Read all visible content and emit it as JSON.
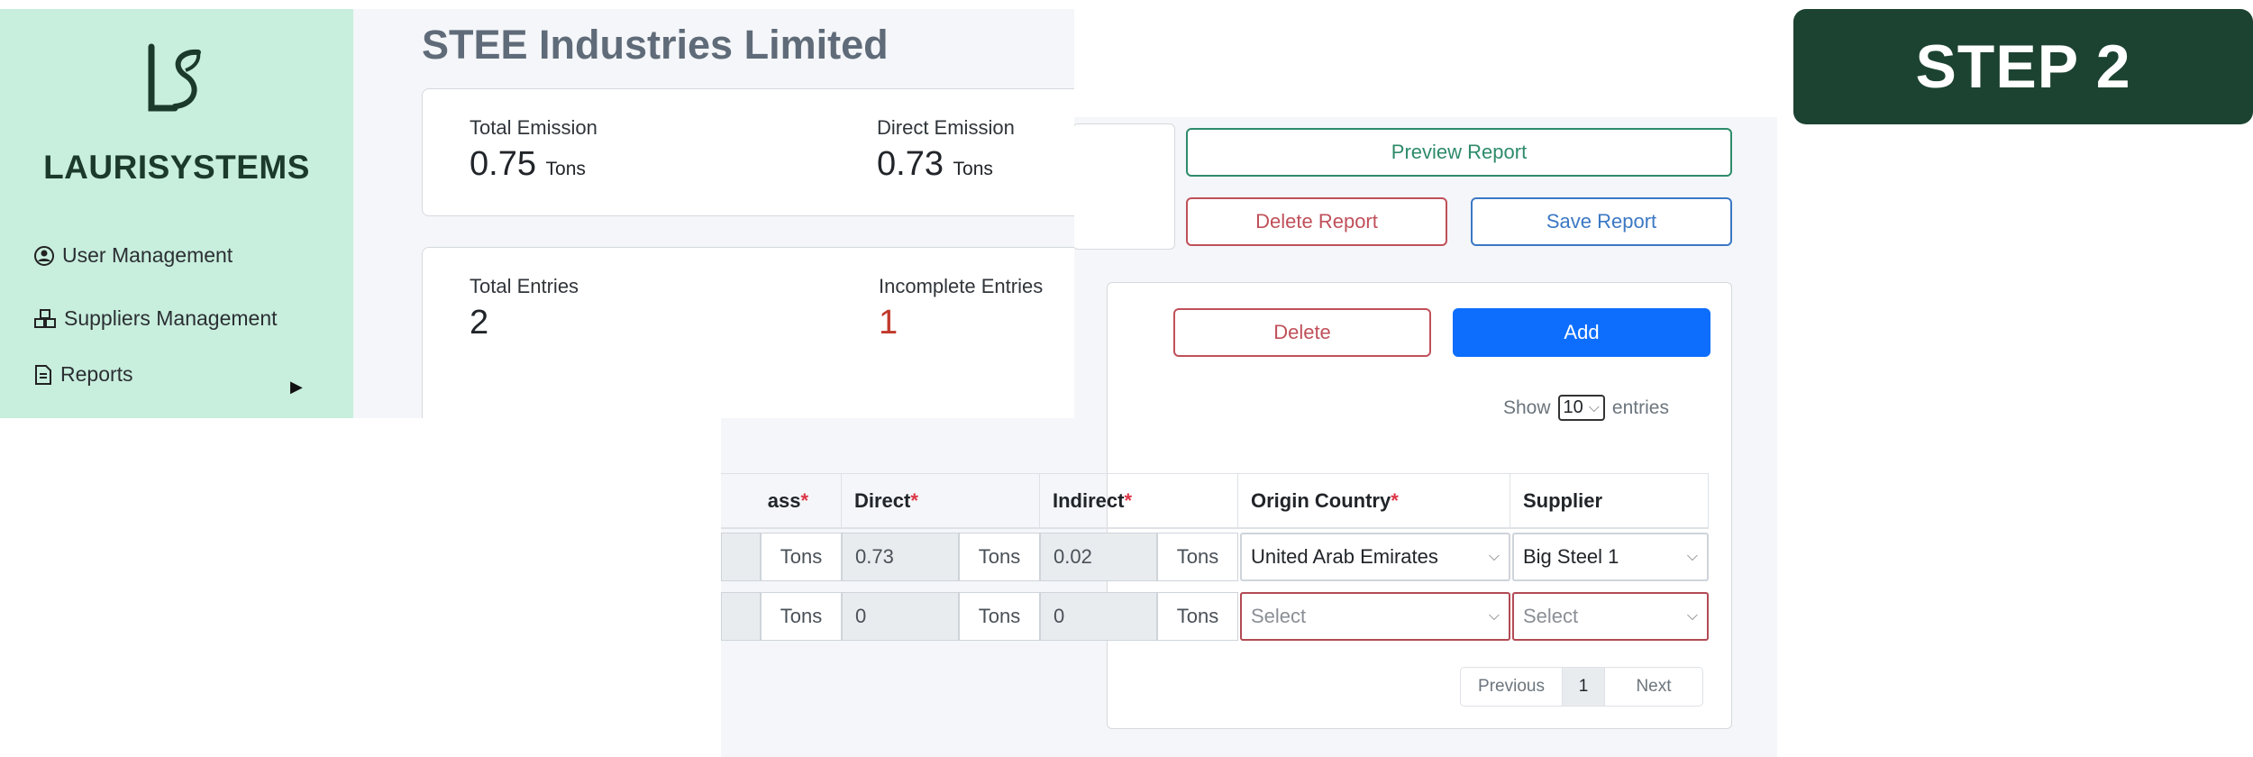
{
  "step_badge": "STEP 2",
  "sidebar": {
    "brand_mark": "LS",
    "brand_name": "LAURISYSTEMS",
    "items": [
      {
        "label": "User Management",
        "icon": "user-circle-icon"
      },
      {
        "label": "Suppliers Management",
        "icon": "boxes-icon"
      },
      {
        "label": "Reports",
        "icon": "document-icon"
      }
    ]
  },
  "header": {
    "company": "STEE Industries Limited"
  },
  "stats": {
    "total_emission": {
      "label": "Total Emission",
      "value": "0.75",
      "unit": "Tons"
    },
    "direct_emission": {
      "label": "Direct Emission",
      "value": "0.73",
      "unit": "Tons"
    },
    "total_entries": {
      "label": "Total Entries",
      "value": "2"
    },
    "incomplete_entries": {
      "label": "Incomplete Entries",
      "value": "1"
    }
  },
  "report_actions": {
    "preview": "Preview Report",
    "delete": "Delete Report",
    "save": "Save Report"
  },
  "entries": {
    "delete": "Delete",
    "add": "Add",
    "show_label": "Show",
    "page_size": "10",
    "entries_label": "entries",
    "columns": {
      "mass": "ass",
      "direct": "Direct",
      "indirect": "Indirect",
      "origin": "Origin Country",
      "supplier": "Supplier",
      "required_mark": "*"
    },
    "rows": [
      {
        "mass_unit": "Tons",
        "direct": "0.73",
        "direct_unit": "Tons",
        "indirect": "0.02",
        "indirect_unit": "Tons",
        "origin": "United Arab Emirates",
        "supplier": "Big Steel 1"
      },
      {
        "mass_unit": "Tons",
        "direct": "0",
        "direct_unit": "Tons",
        "indirect": "0",
        "indirect_unit": "Tons",
        "origin": "Select",
        "supplier": "Select"
      }
    ],
    "pagination": {
      "previous": "Previous",
      "page": "1",
      "next": "Next"
    }
  },
  "colors": {
    "sidebar_bg": "#c8eedd",
    "badge_bg": "#1c4331",
    "primary": "#0d6efd",
    "danger": "#c0505a",
    "success": "#2e8b6a"
  }
}
